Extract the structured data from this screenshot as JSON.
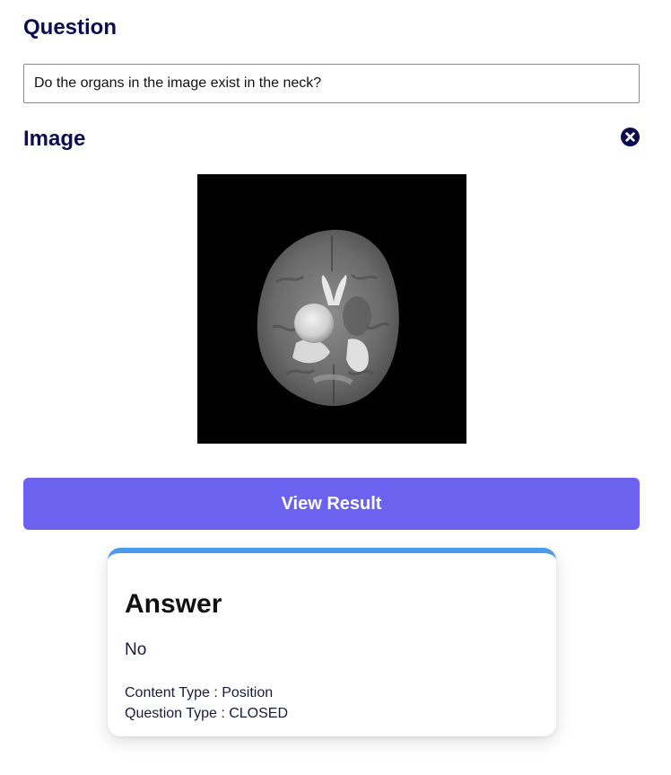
{
  "question": {
    "heading": "Question",
    "input_value": "Do the organs in the image exist in the neck?"
  },
  "image": {
    "heading": "Image",
    "close_icon": "close-circle-icon",
    "content": "brain-mri-axial-slice"
  },
  "view_button": {
    "label": "View Result",
    "color": "#6b63f0"
  },
  "answer": {
    "title": "Answer",
    "value": "No",
    "content_type": "Content Type : Position",
    "question_type": "Question Type : CLOSED",
    "accent_color": "#4f9ae8"
  }
}
